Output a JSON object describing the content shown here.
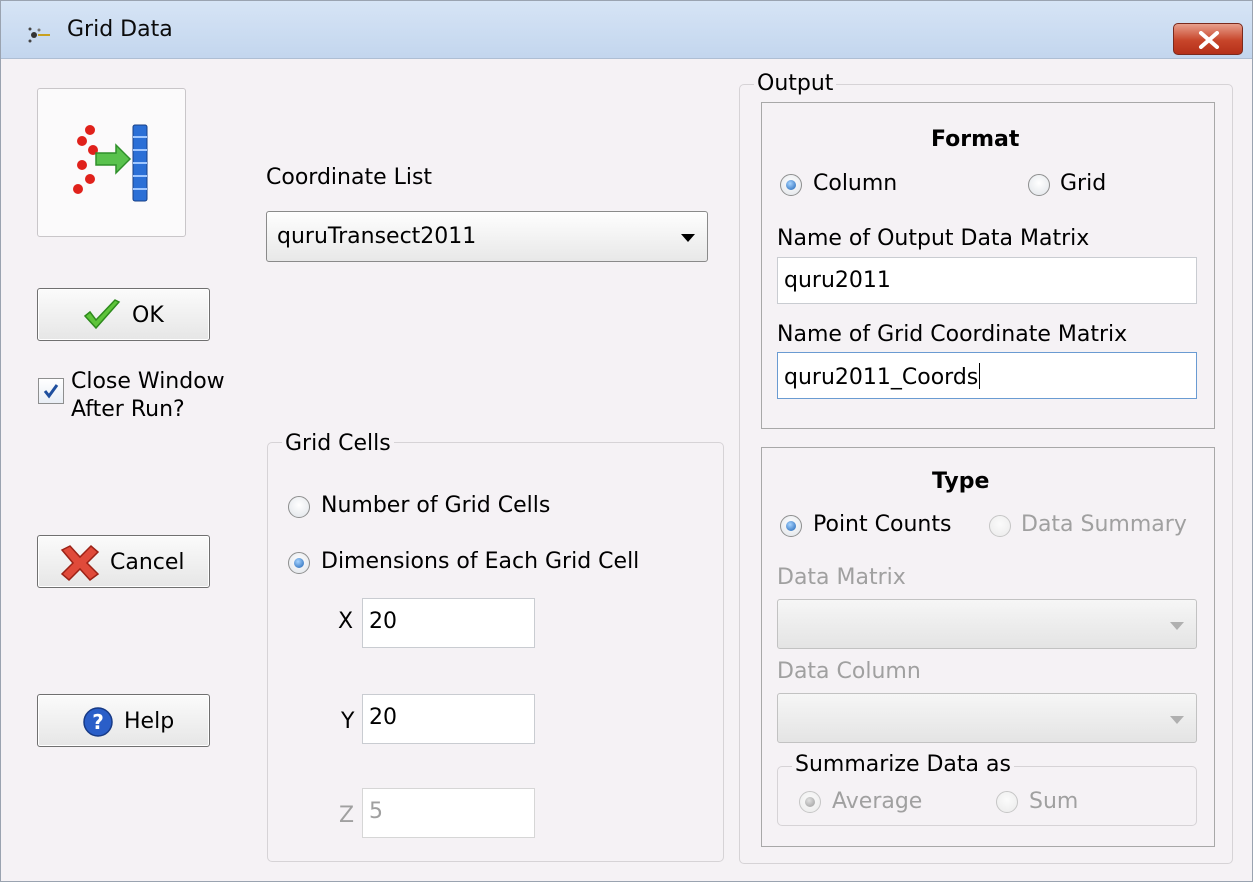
{
  "window": {
    "title": "Grid Data",
    "icon": "grid-data-app-icon"
  },
  "left": {
    "tool_icon": "points-to-grid-icon",
    "ok_label": "OK",
    "close_window_label_line1": "Close Window",
    "close_window_label_line2": "After Run?",
    "close_window_checked": true,
    "cancel_label": "Cancel",
    "help_label": "Help"
  },
  "coordinate_list": {
    "label": "Coordinate List",
    "selected": "quruTransect2011"
  },
  "grid_cells": {
    "title": "Grid Cells",
    "option_number": "Number of Grid Cells",
    "option_dimensions": "Dimensions of Each Grid Cell",
    "selected": "Dimensions of Each Grid Cell",
    "x_label": "X",
    "x_value": "20",
    "y_label": "Y",
    "y_value": "20",
    "z_label": "Z",
    "z_value": "5"
  },
  "output": {
    "title": "Output",
    "format": {
      "title": "Format",
      "option_column": "Column",
      "option_grid": "Grid",
      "selected": "Column",
      "data_matrix_label": "Name of Output Data Matrix",
      "data_matrix_value": "quru2011",
      "coord_matrix_label": "Name of Grid Coordinate Matrix",
      "coord_matrix_value": "quru2011_Coords"
    },
    "type": {
      "title": "Type",
      "option_point_counts": "Point Counts",
      "option_data_summary": "Data Summary",
      "selected": "Point Counts",
      "data_matrix_label": "Data Matrix",
      "data_column_label": "Data Column",
      "summarize_title": "Summarize Data as",
      "option_average": "Average",
      "option_sum": "Sum",
      "summarize_selected": "Average"
    }
  },
  "colors": {
    "title_bar": "#c9dbf1",
    "close_button": "#c7452a",
    "background": "#f5f2f5",
    "radio_selected": "#1d62b4"
  }
}
